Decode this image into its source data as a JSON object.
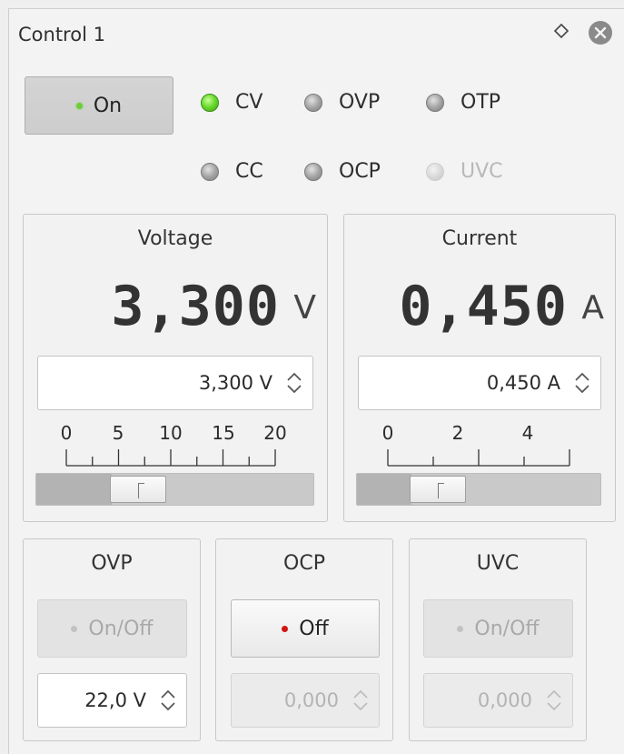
{
  "window": {
    "title": "Control 1"
  },
  "power_button": {
    "label": "On",
    "state": "on",
    "indicator_color": "#6ccf3a"
  },
  "status_leds": [
    {
      "label": "CV",
      "state": "active"
    },
    {
      "label": "OVP",
      "state": "inactive"
    },
    {
      "label": "OTP",
      "state": "inactive"
    },
    {
      "label": "CC",
      "state": "inactive"
    },
    {
      "label": "OCP",
      "state": "inactive"
    },
    {
      "label": "UVC",
      "state": "disabled"
    }
  ],
  "voltage": {
    "title": "Voltage",
    "display_value": "3,300",
    "unit": "V",
    "spin_value": "3,300 V",
    "scale_labels": [
      "0",
      "5",
      "10",
      "15",
      "20"
    ],
    "slider": {
      "min": 0,
      "max": 20,
      "value": 3.3
    }
  },
  "current": {
    "title": "Current",
    "display_value": "0,450",
    "unit": "A",
    "spin_value": "0,450 A",
    "scale_labels": [
      "0",
      "2",
      "4"
    ],
    "slider": {
      "min": 0,
      "max": 5.3,
      "value": 0.45
    }
  },
  "protections": [
    {
      "title": "OVP",
      "button_label": "On/Off",
      "button_enabled": false,
      "spin_value": "22,0 V",
      "spin_enabled": true
    },
    {
      "title": "OCP",
      "button_label": "Off",
      "button_enabled": true,
      "indicator_color": "#d01515",
      "spin_value": "0,000",
      "spin_enabled": false
    },
    {
      "title": "UVC",
      "button_label": "On/Off",
      "button_enabled": false,
      "spin_value": "0,000",
      "spin_enabled": false
    }
  ],
  "icons": {
    "float": "float-diamond-icon",
    "close": "close-circle-icon"
  }
}
